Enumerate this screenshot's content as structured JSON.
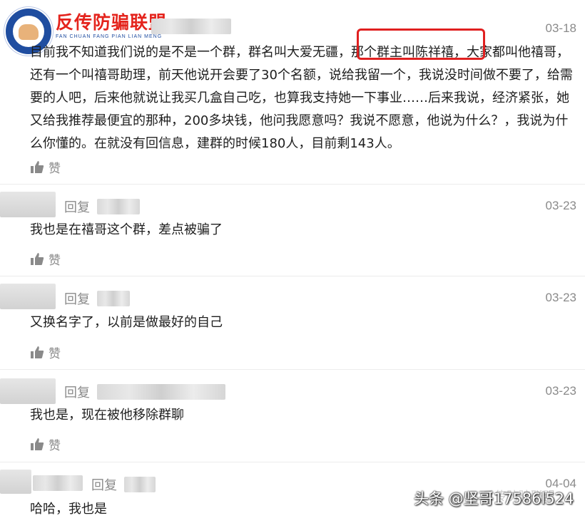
{
  "brand": {
    "name_cn": "反传防骗联盟",
    "name_en": "FAN CHUAN FANG PIAN LIAN MENG"
  },
  "comments": [
    {
      "date": "03-18",
      "text": "目前我不知道我们说的是不是一个群，群名叫大爱无疆，那个群主叫陈祥禧，大家都叫他禧哥，还有一个叫禧哥助理，前天他说开会要了30个名额，说给我留一个，我说没时间做不要了，给需要的人吧，后来他就说让我买几盒自己吃，也算我支持她一下事业……后来我说，经济紧张，她又给我推荐最便宜的那种，200多块钱，他问我愿意吗？我说不愿意，他说为什么？，我说为什么你懂的。在就没有回信息，建群的时候180人，目前剩143人。",
      "like_label": "赞"
    },
    {
      "date": "03-23",
      "reply_label": "回复",
      "text": "我也是在禧哥这个群，差点被骗了",
      "like_label": "赞"
    },
    {
      "date": "03-23",
      "reply_label": "回复",
      "text": "又换名字了，以前是做最好的自己",
      "like_label": "赞"
    },
    {
      "date": "03-23",
      "reply_label": "回复",
      "text": "我也是，现在被他移除群聊",
      "like_label": "赞"
    },
    {
      "date": "04-04",
      "reply_label": "回复",
      "text": "哈哈，我也是"
    }
  ],
  "watermark": {
    "text": "头条 @坚哥17586l524",
    "secondary": "反传防骗联盟"
  },
  "colors": {
    "highlight": "#e02020",
    "brand_red": "#e4231c",
    "brand_blue": "#1f4da0",
    "meta_gray": "#8a8a8a"
  }
}
